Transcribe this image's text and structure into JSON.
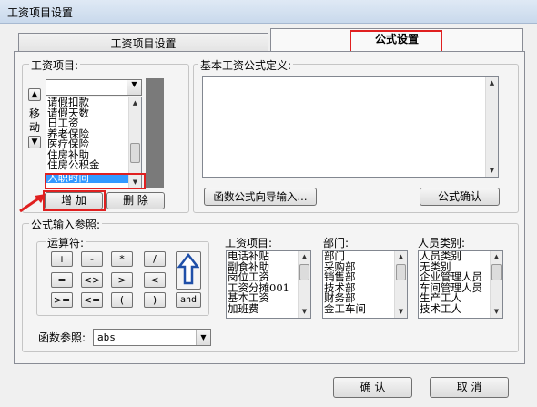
{
  "window": {
    "title": "工资项目设置"
  },
  "tabs": [
    {
      "label": "工资项目设置",
      "active": false
    },
    {
      "label": "公式设置",
      "active": true
    }
  ],
  "salary_items": {
    "legend": "工资项目:",
    "combo_value": "",
    "move_label_1": "移",
    "move_label_2": "动",
    "list": [
      "请假扣款",
      "请假天数",
      "日工资",
      "养老保险",
      "医疗保险",
      "住房补助",
      "住房公积金",
      "入职时间"
    ],
    "add_button": "增 加",
    "delete_button": "删 除"
  },
  "formula": {
    "legend": "基本工资公式定义:",
    "text": "",
    "wizard_button": "函数公式向导输入...",
    "confirm_button": "公式确认"
  },
  "params": {
    "legend": "公式输入参照:",
    "operators_legend": "运算符:",
    "operators": [
      "+",
      "-",
      "*",
      "/",
      "=",
      "<>",
      ">",
      "<",
      ">=",
      "<=",
      "(",
      ")"
    ],
    "and_label": "and",
    "salary_legend": "工资项目:",
    "salary_list": [
      "电话补贴",
      "副食补助",
      "岗位工资",
      "工资分摊001",
      "基本工资",
      "加班费"
    ],
    "dept_legend": "部门:",
    "dept_list": [
      "部门",
      "采购部",
      "销售部",
      "技术部",
      "财务部",
      "金工车间"
    ],
    "category_legend": "人员类别:",
    "category_list": [
      "人员类别",
      "无类别",
      "企业管理人员",
      "车间管理人员",
      "生产工人",
      "技术工人"
    ],
    "function_label": "函数参照:",
    "function_value": "abs"
  },
  "footer": {
    "ok_button": "确 认",
    "cancel_button": "取 消"
  },
  "colors": {
    "highlight": "#3399ff",
    "annotation": "#e02020"
  }
}
